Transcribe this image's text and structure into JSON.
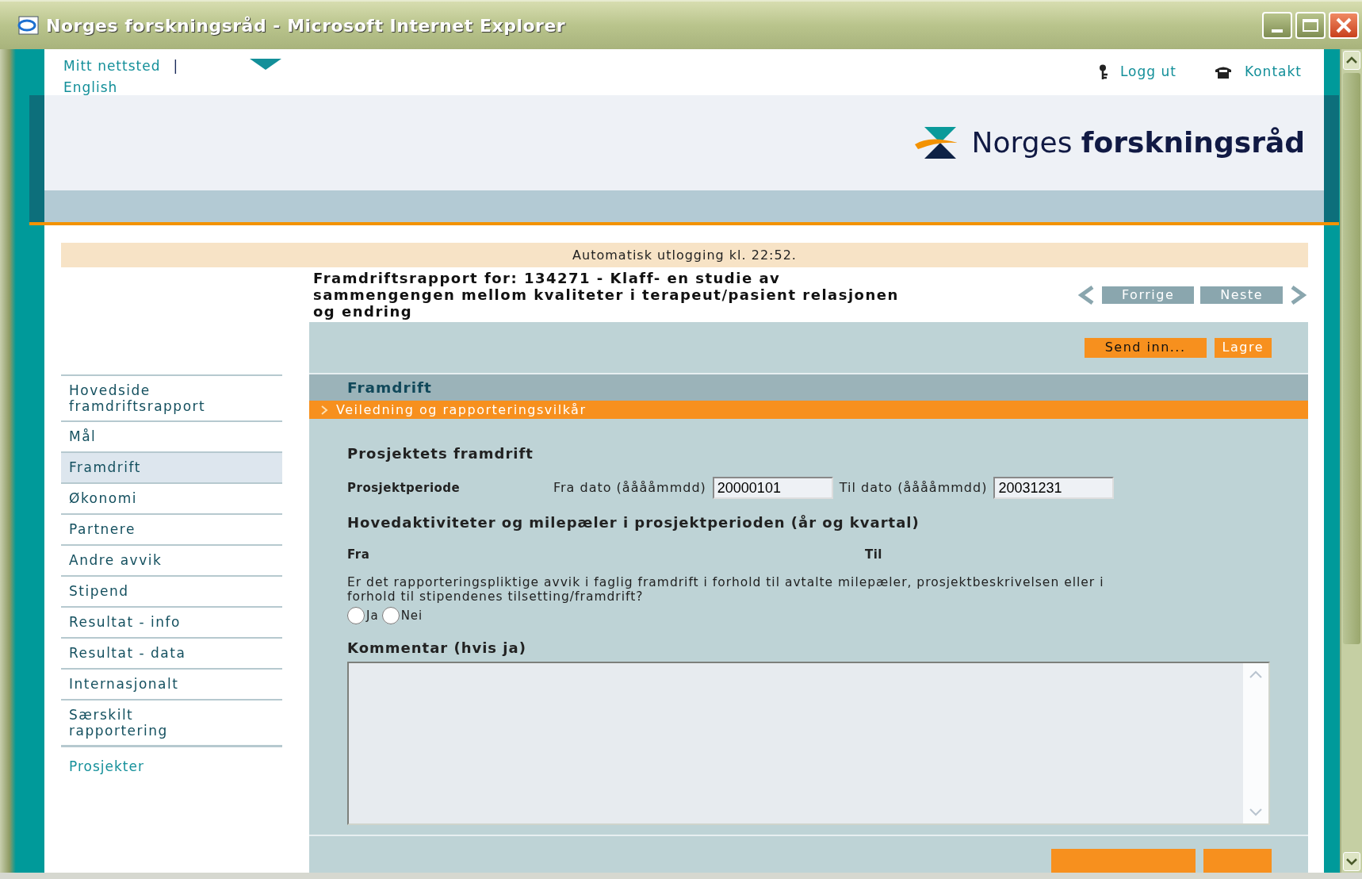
{
  "window": {
    "title": "Norges forskningsråd - Microsoft Internet Explorer"
  },
  "site_links": [
    "Mitt nettsted",
    "English"
  ],
  "separator": "|",
  "user_links": [
    {
      "label": "Logg ut",
      "kind": "key"
    },
    {
      "label": "Kontakt",
      "kind": "phone"
    }
  ],
  "logo": "Norges **forskningsråd**",
  "notice": "Automatisk utlogging kl. 22:52.",
  "report_title": "Framdriftsrapport for: 134271 - Klaff- en studie av sammengengen mellom kvaliteter i terapeut/pasient relasjonen og endring",
  "pager": {
    "prev": "Forrige",
    "next": "Neste"
  },
  "actions": [
    {
      "label": "Send inn...",
      "kind": "submit"
    },
    {
      "label": "Lagre",
      "kind": "save"
    }
  ],
  "sidebar": {
    "items": [
      {
        "label": "Hovedside framdriftsrapport",
        "selected": false
      },
      {
        "label": "Mål",
        "selected": false
      },
      {
        "label": "Framdrift",
        "selected": true
      },
      {
        "label": "Økonomi",
        "selected": false
      },
      {
        "label": "Partnere",
        "selected": false
      },
      {
        "label": "Andre avvik",
        "selected": false
      },
      {
        "label": "Stipend",
        "selected": false
      },
      {
        "label": "Resultat - info",
        "selected": false
      },
      {
        "label": "Resultat - data",
        "selected": false
      },
      {
        "label": "Internasjonalt",
        "selected": false
      },
      {
        "label": "Særskilt rapportering",
        "selected": false
      }
    ],
    "footer_link": "Prosjekter"
  },
  "section": {
    "title": "Framdrift",
    "guide_link": "Veiledning og rapporteringsvilkår"
  },
  "form": {
    "heading": "Prosjektets framdrift",
    "period_label": "Prosjektperiode",
    "from_label": "Fra dato (ååååmmdd)",
    "from_value": "20000101",
    "to_label": "Til dato (ååååmmdd)",
    "to_value": "20031231",
    "activities_heading": "Hovedaktiviteter og milepæler i prosjektperioden (år og kvartal)",
    "col_from": "Fra",
    "col_to": "Til",
    "question": "Er det rapporteringspliktige avvik i faglig framdrift i forhold til avtalte milepæler, prosjektbeskrivelsen eller i forhold til stipendenes tilsetting/framdrift?",
    "options": [
      {
        "label": "Ja",
        "selected": false
      },
      {
        "label": "Nei",
        "selected": false
      }
    ],
    "comment_label": "Kommentar (hvis ja)"
  }
}
